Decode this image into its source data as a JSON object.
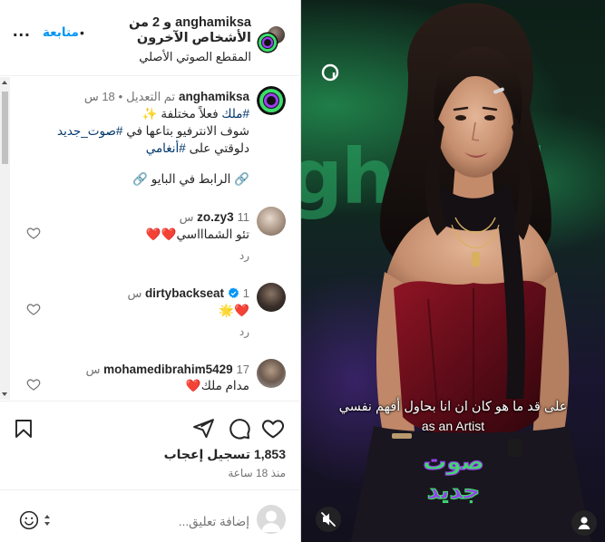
{
  "header": {
    "title": "anghamiksa و 2 من الأشخاص الآخرون",
    "audio": "المقطع الصوتي الأصلي",
    "follow_label": "متابعة",
    "dot": "•",
    "more": "..."
  },
  "caption": {
    "username": "anghamiksa",
    "edited": "تم التعديل",
    "dot": "•",
    "time": "18 س",
    "line1_tag": "#ملك",
    "line1_text": " فعلاً مختلفة ✨",
    "line2_text": "شوف الانترفيو بتاعها في ",
    "line2_tag": "#صوت_جديد",
    "line3_text": "دلوقتي على ",
    "line3_tag": "#أنغامي",
    "link_text": "🔗 الرابط في البايو 🔗"
  },
  "comments": [
    {
      "username": "zo.zy3",
      "time": "11 س",
      "text": "تئو الشماااسي❤️❤️",
      "reply": "رد"
    },
    {
      "username": "dirtybackseat",
      "verified": true,
      "time": "1 س",
      "text": "❤️🌟",
      "reply": "رد"
    },
    {
      "username": "mohamedibrahim5429",
      "time": "17 س",
      "text": "مدام ملك❤️",
      "reply": "رد"
    }
  ],
  "actions": {
    "likes": "1,853 تسجيل إعجاب",
    "time": "منذ 18 ساعة",
    "icons": [
      "heart-icon",
      "comment-icon",
      "share-icon",
      "save-icon"
    ]
  },
  "composer": {
    "placeholder": "إضافة تعليق..."
  },
  "video": {
    "subtitle_ar": "على قد ما هو  كان ان انا بحاول أفهم نفسي",
    "subtitle_en": "as an Artist",
    "bg_text": "ghami",
    "badge_lines": [
      "صوت",
      "جديد"
    ],
    "accent": "#3ddc6b",
    "badge_purple": "#9b3df0"
  },
  "colors": {
    "link": "#0095f6",
    "hashtag": "#00376b",
    "heart": "#ed4956",
    "verified": "#0095f6"
  }
}
